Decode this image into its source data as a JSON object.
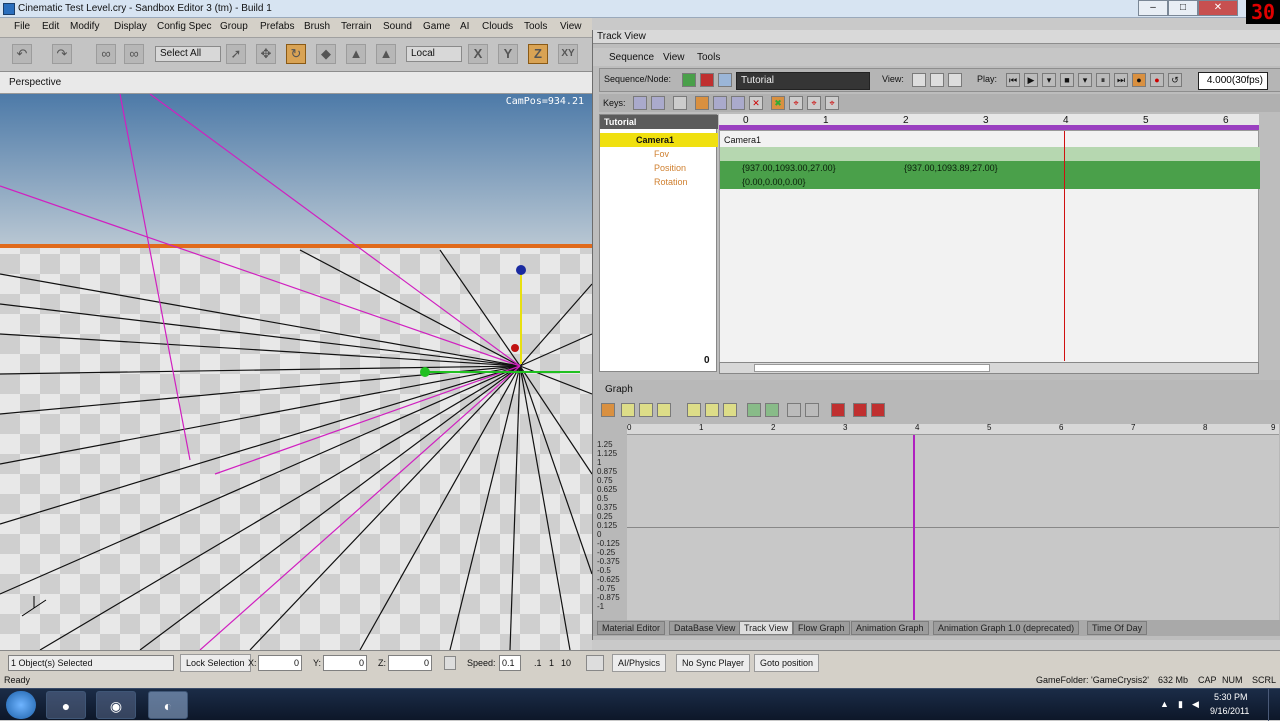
{
  "window": {
    "title": "Cinematic Test Level.cry - Sandbox Editor 3 (tm) - Build 1",
    "fps": "30",
    "minimize": "–",
    "maximize": "□",
    "close": "✕"
  },
  "menu": [
    "File",
    "Edit",
    "Modify",
    "Display",
    "Config Spec",
    "Group",
    "Prefabs",
    "Brush",
    "Terrain",
    "Sound",
    "Game",
    "AI",
    "Clouds",
    "Tools",
    "View"
  ],
  "toolbar": {
    "select_all": "Select All",
    "coord": "Local",
    "axis_x": "X",
    "axis_y": "Y",
    "axis_z": "Z",
    "axis_xy": "XY"
  },
  "viewport": {
    "title": "Perspective",
    "campos": "CamPos=934.21"
  },
  "trackview": {
    "title": "Track View",
    "menu": [
      "Sequence",
      "View",
      "Tools"
    ],
    "sequence_label": "Sequence/Node:",
    "sequence_name": "Tutorial",
    "view_label": "View:",
    "play_label": "Play:",
    "time": "4.000(30fps)",
    "keys_label": "Keys:",
    "zero": "0",
    "tree": {
      "root": "Tutorial",
      "camera": "Camera1",
      "fov": "Fov",
      "position": "Position",
      "rotation": "Rotation"
    },
    "ruler": [
      "0",
      "1",
      "2",
      "3",
      "4",
      "5",
      "6"
    ],
    "tracks": {
      "camera": "Camera1",
      "pos_key1": "{937.00,1093.00,27.00}",
      "pos_key2": "{937.00,1093.89,27.00}",
      "rot_key1": "{0.00,0.00,0.00}"
    },
    "graph_title": "Graph",
    "graph_ruler": [
      "0",
      "1",
      "2",
      "3",
      "4",
      "5",
      "6",
      "7",
      "8",
      "9"
    ],
    "graph_y": [
      "1.25",
      "1.125",
      "1",
      "0.875",
      "0.75",
      "0.625",
      "0.5",
      "0.375",
      "0.25",
      "0.125",
      "0",
      "-0.125",
      "-0.25",
      "-0.375",
      "-0.5",
      "-0.625",
      "-0.75",
      "-0.875",
      "-1"
    ],
    "tabs": [
      "Material Editor",
      "DataBase View",
      "Track View",
      "Flow Graph",
      "Animation Graph",
      "Animation Graph 1.0 (deprecated)",
      "Time Of Day"
    ]
  },
  "status": {
    "selected": "1 Object(s) Selected",
    "lock": "Lock Selection",
    "x_label": "X:",
    "x": "0",
    "y_label": "Y:",
    "y": "0",
    "z_label": "Z:",
    "z": "0",
    "speed_label": "Speed:",
    "speed": "0.1",
    "s1": ".1",
    "s2": "1",
    "s3": "10",
    "ai": "AI/Physics",
    "sync": "No Sync Player",
    "goto": "Goto position",
    "ready": "Ready",
    "gamefolder": "GameFolder: 'GameCrysis2'",
    "mem": "632 Mb",
    "cap": "CAP",
    "num": "NUM",
    "scrl": "SCRL"
  },
  "taskbar": {
    "time": "5:30 PM",
    "date": "9/16/2011"
  }
}
